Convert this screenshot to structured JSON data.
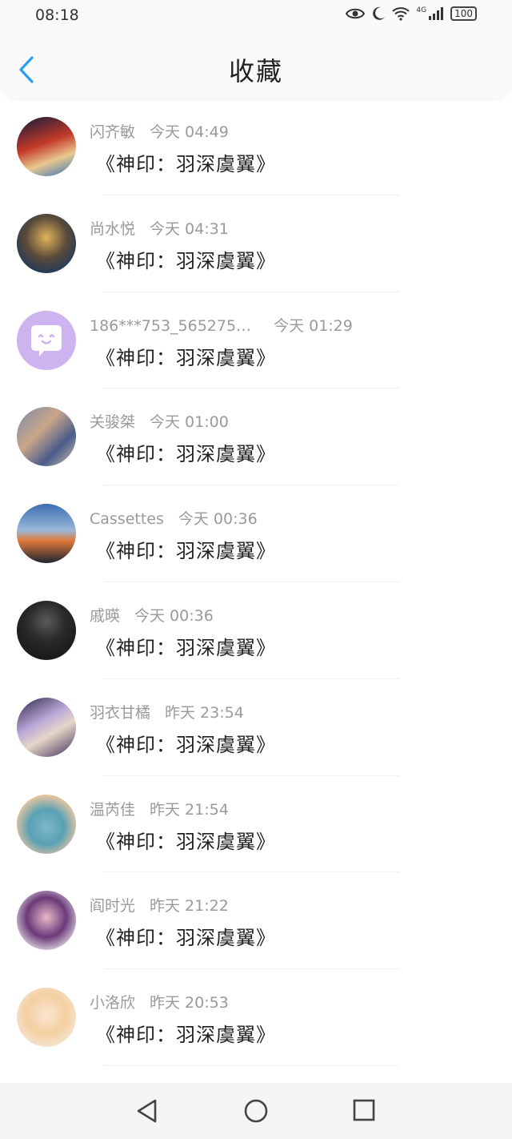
{
  "status": {
    "time": "08:18",
    "network": "4G",
    "battery": "100"
  },
  "header": {
    "title": "收藏"
  },
  "items": [
    {
      "name": "闪齐敏",
      "time": "今天 04:49",
      "message": "《神印：羽深虞翼》"
    },
    {
      "name": "尚水悦",
      "time": "今天 04:31",
      "message": "《神印：羽深虞翼》"
    },
    {
      "name": "186***753_565275…",
      "time": "今天 01:29",
      "message": "《神印：羽深虞翼》"
    },
    {
      "name": "关骏桀",
      "time": "今天 01:00",
      "message": "《神印：羽深虞翼》"
    },
    {
      "name": "Cassettes",
      "time": "今天 00:36",
      "message": "《神印：羽深虞翼》"
    },
    {
      "name": "戚暎",
      "time": "今天 00:36",
      "message": "《神印：羽深虞翼》"
    },
    {
      "name": "羽衣甘橘",
      "time": "昨天 23:54",
      "message": "《神印：羽深虞翼》"
    },
    {
      "name": "温芮佳",
      "time": "昨天 21:54",
      "message": "《神印：羽深虞翼》"
    },
    {
      "name": "阎时光",
      "time": "昨天 21:22",
      "message": "《神印：羽深虞翼》"
    },
    {
      "name": "小洛欣",
      "time": "昨天 20:53",
      "message": "《神印：羽深虞翼》"
    }
  ],
  "colors": {
    "accent": "#2a9df4",
    "meta_text": "#9a9a9a",
    "default_avatar": "#cdb4f0"
  }
}
